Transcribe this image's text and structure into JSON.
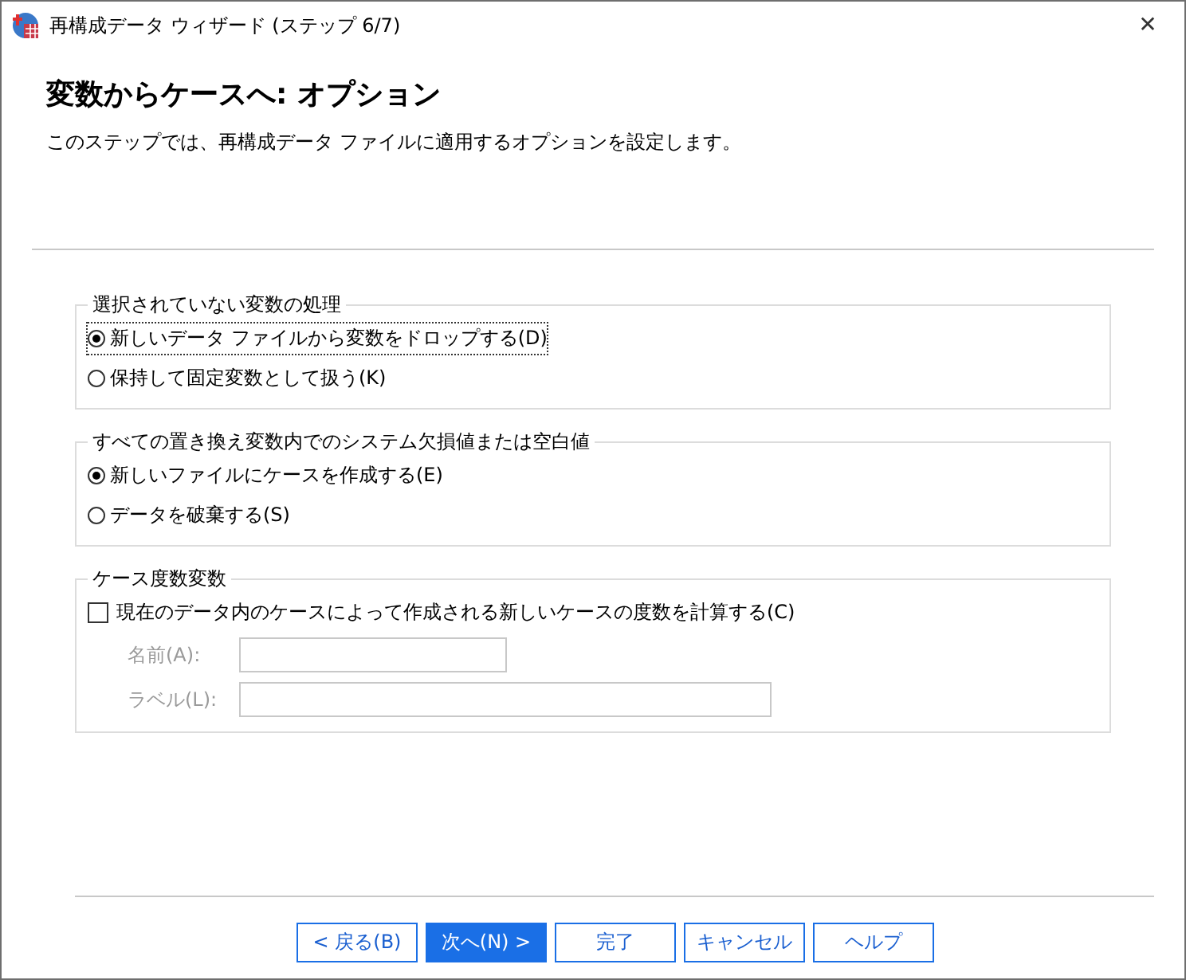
{
  "window": {
    "title": "再構成データ ウィザード (ステップ 6/7)",
    "close": "✕"
  },
  "heading": "変数からケースへ: オプション",
  "description": "このステップでは、再構成データ ファイルに適用するオプションを設定します。",
  "groups": [
    {
      "title": "選択されていない変数の処理",
      "kind": "radio",
      "options": [
        {
          "label": "新しいデータ ファイルから変数をドロップする(D)",
          "selected": true,
          "focused": true
        },
        {
          "label": "保持して固定変数として扱う(K)",
          "selected": false,
          "focused": false
        }
      ]
    },
    {
      "title": "すべての置き換え変数内でのシステム欠損値または空白値",
      "kind": "radio",
      "options": [
        {
          "label": "新しいファイルにケースを作成する(E)",
          "selected": true,
          "focused": false
        },
        {
          "label": "データを破棄する(S)",
          "selected": false,
          "focused": false
        }
      ]
    },
    {
      "title": "ケース度数変数",
      "kind": "checkbox",
      "checkbox": {
        "label": "現在のデータ内のケースによって作成される新しいケースの度数を計算する(C)",
        "checked": false
      },
      "fields": [
        {
          "label": "名前(A):",
          "disabled": true,
          "wide": false
        },
        {
          "label": "ラベル(L):",
          "disabled": true,
          "wide": true
        }
      ]
    }
  ],
  "buttons": [
    {
      "label": "< 戻る(B)",
      "primary": false
    },
    {
      "label": "次へ(N) >",
      "primary": true
    },
    {
      "label": "完了",
      "primary": false
    },
    {
      "label": "キャンセル",
      "primary": false
    },
    {
      "label": "ヘルプ",
      "primary": false
    }
  ]
}
